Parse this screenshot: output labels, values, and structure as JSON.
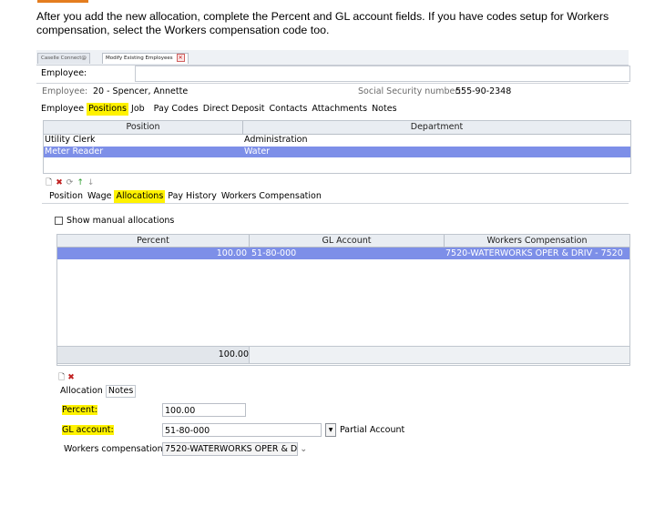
{
  "instruction": "After you add the new allocation, complete the Percent and GL account fields.  If you have codes setup for Workers compensation, select the Workers compensation code too.",
  "doc_tabs": [
    "Caselle Connect@",
    "Modify Existing Employees"
  ],
  "employee_label": "Employee:",
  "employee_info": {
    "label": "Employee:",
    "value": "20 - Spencer, Annette",
    "ssn_label": "Social Security number:",
    "ssn_value": "555-90-2348"
  },
  "main_tabs": [
    "Employee",
    "Positions",
    "Job",
    "Pay Codes",
    "Direct Deposit",
    "Contacts",
    "Attachments",
    "Notes"
  ],
  "positions_grid": {
    "headers": [
      "Position",
      "Department"
    ],
    "rows": [
      [
        "Utility Clerk",
        "Administration"
      ],
      [
        "Meter Reader",
        "Water"
      ]
    ]
  },
  "position_tabs": [
    "Position",
    "Wage",
    "Allocations",
    "Pay History",
    "Workers Compensation"
  ],
  "show_manual_label": "Show manual allocations",
  "alloc_grid": {
    "headers": [
      "Percent",
      "GL Account",
      "Workers Compensation"
    ],
    "rows": [
      [
        "100.00",
        "51-80-000",
        "7520-WATERWORKS OPER & DRIV - 7520"
      ]
    ],
    "total": "100.00"
  },
  "detail_tabs": [
    "Allocation",
    "Notes"
  ],
  "form": {
    "percent_label": "Percent:",
    "percent_value": "100.00",
    "gl_label": "GL account:",
    "gl_value": "51-80-000",
    "partial_label": "Partial Account",
    "wc_label": "Workers compensation:",
    "wc_value": "7520-WATERWORKS OPER & D"
  },
  "colors": {
    "highlight": "#fff200",
    "selection": "#7d8fe8",
    "accent_bar": "#e47d1f"
  }
}
